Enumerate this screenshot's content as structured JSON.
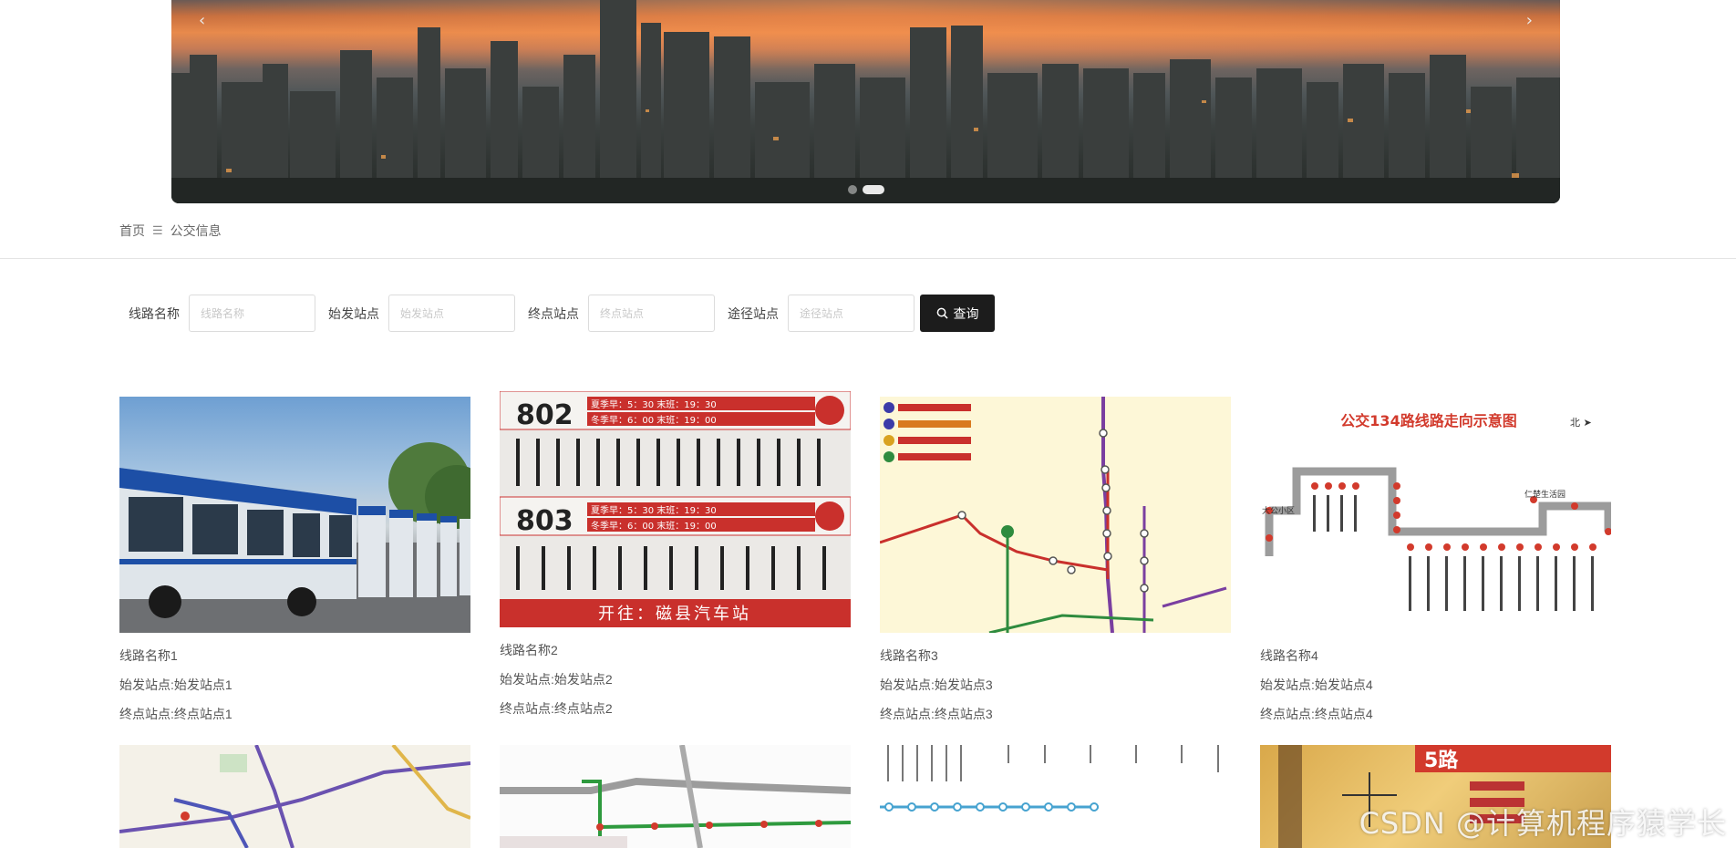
{
  "banner": {
    "prev_label": "‹",
    "next_label": "›",
    "slide_count": 2,
    "active_slide": 1
  },
  "breadcrumb": {
    "home": "首页",
    "separator": "☰",
    "current": "公交信息"
  },
  "search": {
    "fields": [
      {
        "label": "线路名称",
        "placeholder": "线路名称"
      },
      {
        "label": "始发站点",
        "placeholder": "始发站点"
      },
      {
        "label": "终点站点",
        "placeholder": "终点站点"
      },
      {
        "label": "途径站点",
        "placeholder": "途径站点"
      }
    ],
    "button_label": "查询",
    "button_icon": "search-icon"
  },
  "cards": [
    {
      "route_name": "线路名称1",
      "start_line": "始发站点:始发站点1",
      "end_line": "终点站点:终点站点1"
    },
    {
      "route_name": "线路名称2",
      "start_line": "始发站点:始发站点2",
      "end_line": "终点站点:终点站点2"
    },
    {
      "route_name": "线路名称3",
      "start_line": "始发站点:始发站点3",
      "end_line": "终点站点:终点站点3"
    },
    {
      "route_name": "线路名称4",
      "start_line": "始发站点:始发站点4",
      "end_line": "终点站点:终点站点4"
    }
  ],
  "thumb_text": {
    "sign_802": "802",
    "sign_803": "803",
    "sign_802_times_1": "夏季早：5：30 末班：19：30",
    "sign_802_times_2": "冬季早：6：00 末班：19：00",
    "sign_803_times_1": "夏季早：5：30 末班：19：30",
    "sign_803_times_2": "冬季早：6：00 末班：19：00",
    "sign_footer": "开往：磁县汽车站",
    "route_title": "公交134路线路走向示意图",
    "route_north": "北 ➤",
    "route_left_stop": "大公小区",
    "route_right_stop": "仁楚生活园",
    "old_sign_title": "5路"
  },
  "watermark": "CSDN @计算机程序猿学长"
}
